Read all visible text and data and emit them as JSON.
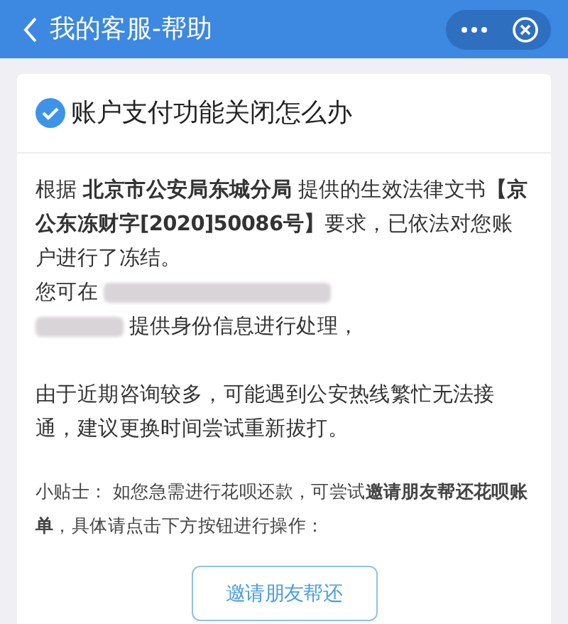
{
  "header": {
    "title": "我的客服-帮助"
  },
  "card": {
    "title": "账户支付功能关闭怎么办",
    "paragraphs": [
      {
        "kind": "text",
        "text": "根据 **北京市公安局东城分局** 提供的生效法律文书**【京公东冻财字[2020]50086号】**要求，已依法对您账户进行了冻结。"
      },
      {
        "kind": "redacted",
        "lead": "您可在",
        "tail": "提供身份信息进行处理，"
      },
      {
        "kind": "text",
        "text": "由于近期咨询较多，可能遇到公安热线繁忙无法接通，建议更换时间尝试重新拔打。"
      }
    ],
    "tip": "小贴士： 如您急需进行花呗还款，可尝试**邀请朋友帮还花呗账单**，具体请点击下方按钮进行操作：",
    "button": "邀请朋友帮还"
  }
}
